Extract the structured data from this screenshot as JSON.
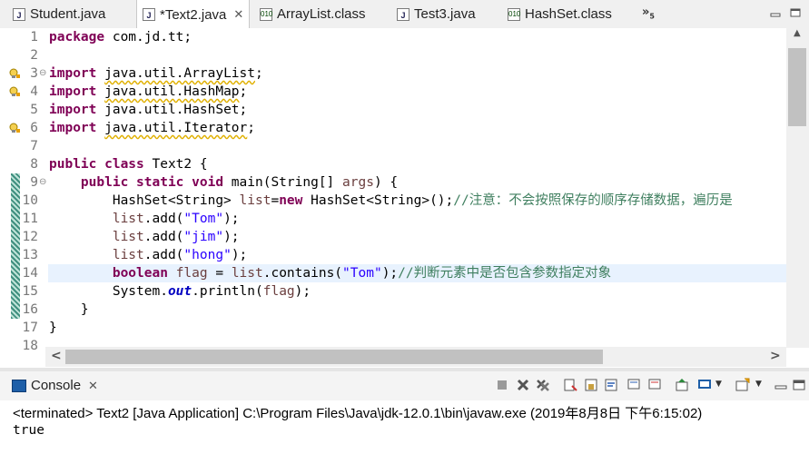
{
  "tabs": [
    {
      "label": "Student.java",
      "icon": "java-file-icon"
    },
    {
      "label": "*Text2.java",
      "icon": "java-file-icon",
      "active": true
    },
    {
      "label": "ArrayList.class",
      "icon": "class-file-icon"
    },
    {
      "label": "Test3.java",
      "icon": "java-file-icon"
    },
    {
      "label": "HashSet.class",
      "icon": "class-file-icon"
    }
  ],
  "overflow_label": "»",
  "overflow_count": "5",
  "line_numbers": [
    "1",
    "2",
    "3",
    "4",
    "5",
    "6",
    "7",
    "8",
    "9",
    "10",
    "11",
    "12",
    "13",
    "14",
    "15",
    "16",
    "17",
    "18"
  ],
  "code": {
    "l1": {
      "kw": "package",
      "rest": " com.jd.tt;"
    },
    "l3": {
      "kw": "import",
      "pkg": "java.util.ArrayList",
      "end": ";"
    },
    "l4": {
      "kw": "import",
      "pkg": "java.util.HashMap",
      "end": ";"
    },
    "l5": {
      "kw": "import",
      "pkg": "java.util.HashSet",
      "end": ";"
    },
    "l6": {
      "kw": "import",
      "pkg": "java.util.Iterator",
      "end": ";"
    },
    "l8": {
      "kw": "public class",
      "rest": " Text2 {"
    },
    "l9": {
      "kw": "public static void",
      "rest1": " main(String[] ",
      "var": "args",
      "rest2": ") {"
    },
    "l10": {
      "pre": "HashSet<String> ",
      "var": "list",
      "mid": "=",
      "kw": "new",
      "post": " HashSet<String>();",
      "comment": "//注意：不会按照保存的顺序存储数据，遍历是"
    },
    "l11": {
      "var": "list",
      "pre": ".add(",
      "str": "\"Tom\"",
      "post": ");"
    },
    "l12": {
      "var": "list",
      "pre": ".add(",
      "str": "\"jim\"",
      "post": ");"
    },
    "l13": {
      "var": "list",
      "pre": ".add(",
      "str": "\"hong\"",
      "post": ");"
    },
    "l14": {
      "kw": "boolean",
      "var": "flag",
      "mid": " = ",
      "var2": "list",
      "pre": ".contains(",
      "str": "\"Tom\"",
      "post": ");",
      "comment": "//判断元素中是否包含参数指定对象"
    },
    "l15": {
      "pre": "System.",
      "field": "out",
      "post": ".println(",
      "var": "flag",
      "end": ");"
    },
    "l16": {
      "rest": "}"
    },
    "l17": {
      "rest": "}"
    }
  },
  "console": {
    "tab_label": "Console",
    "terminated": "<terminated> Text2 [Java Application] C:\\Program Files\\Java\\jdk-12.0.1\\bin\\javaw.exe (2019年8月8日 下午6:15:02)",
    "output": "true"
  },
  "colors": {
    "keyword": "#7f0055",
    "string": "#2a00ff",
    "comment": "#3f7f5f",
    "current_line": "#e8f2fe"
  }
}
